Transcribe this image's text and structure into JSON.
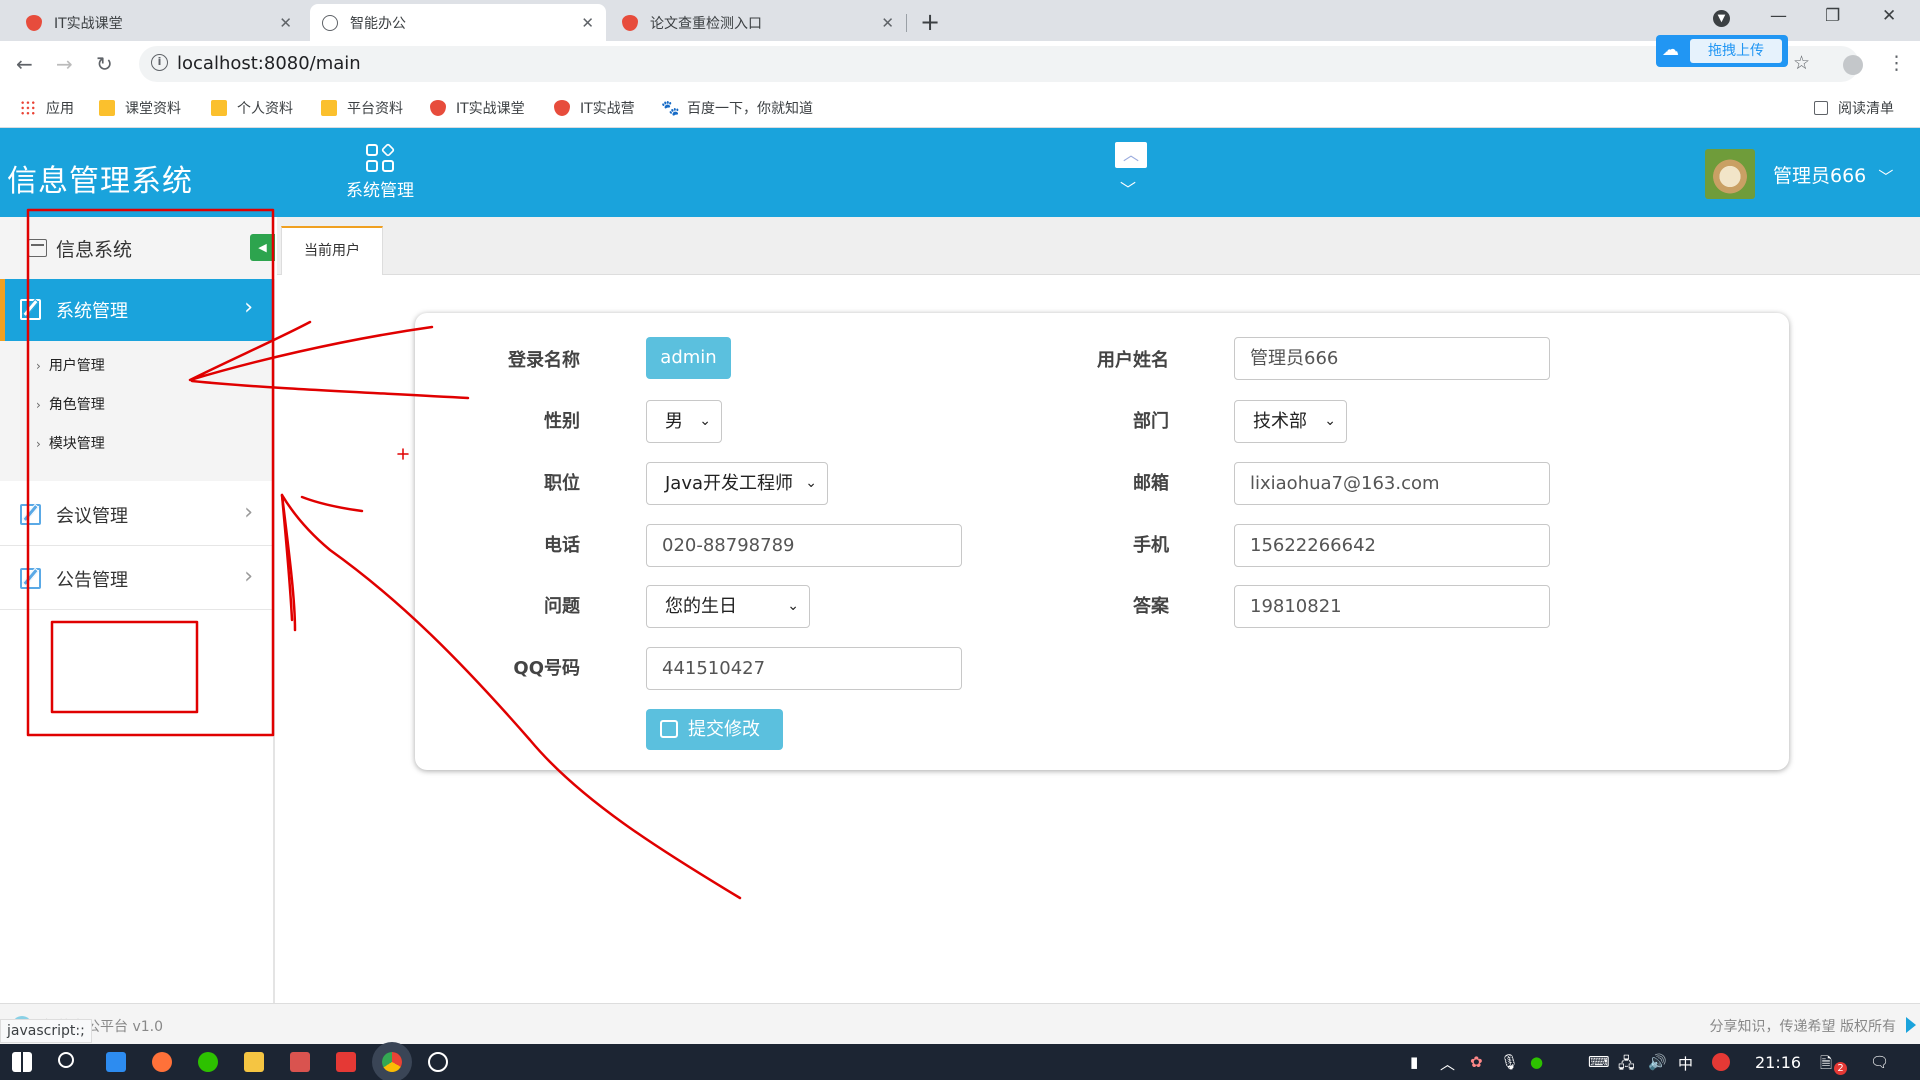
{
  "browser": {
    "tabs": [
      {
        "title": "IT实战课堂",
        "active": false
      },
      {
        "title": "智能办公",
        "active": true
      },
      {
        "title": "论文查重检测入口",
        "active": false
      }
    ],
    "url": "localhost:8080/main",
    "upload_widget": "拖拽上传",
    "bookmarks": [
      "应用",
      "课堂资料",
      "个人资料",
      "平台资料",
      "IT实战课堂",
      "IT实战营",
      "百度一下，你就知道"
    ],
    "reading_list": "阅读清单",
    "status_url": "javascript:;"
  },
  "header": {
    "title": "信息管理系统",
    "nav_label": "系统管理",
    "user_name": "管理员666"
  },
  "sidebar": {
    "heading": "信息系统",
    "menus": [
      {
        "label": "系统管理",
        "active": true,
        "children": [
          "用户管理",
          "角色管理",
          "模块管理"
        ]
      },
      {
        "label": "会议管理",
        "active": false
      },
      {
        "label": "公告管理",
        "active": false
      }
    ]
  },
  "tabs": {
    "current": "当前用户"
  },
  "form": {
    "login_label": "登录名称",
    "login_value": "admin",
    "username_label": "用户姓名",
    "username_value": "管理员666",
    "gender_label": "性别",
    "gender_value": "男",
    "dept_label": "部门",
    "dept_value": "技术部",
    "position_label": "职位",
    "position_value": "Java开发工程师",
    "email_label": "邮箱",
    "email_value": "lixiaohua7@163.com",
    "phone_label": "电话",
    "phone_value": "020-88798789",
    "mobile_label": "手机",
    "mobile_value": "15622266642",
    "question_label": "问题",
    "question_value": "您的生日",
    "answer_label": "答案",
    "answer_value": "19810821",
    "qq_label": "QQ号码",
    "qq_value": "441510427",
    "submit_label": "提交修改"
  },
  "footer": {
    "left": "智能办公平台 v1.0",
    "right": "分享知识，传递希望 版权所有"
  },
  "taskbar": {
    "time": "21:16",
    "ime": "中",
    "notification_count": "2"
  },
  "colors": {
    "primary": "#1aa3dc",
    "accent": "#f0a020",
    "button": "#5bc0de",
    "annotation": "#e00000"
  }
}
